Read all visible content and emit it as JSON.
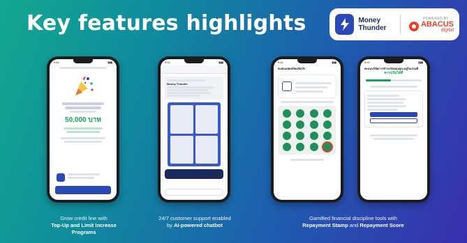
{
  "header": {
    "title": "Key features highlights",
    "brand_name": "Money Thunder",
    "powered_by": "POWERED BY",
    "partner_name": "ABACUS",
    "partner_sub": "digital"
  },
  "captions": [
    {
      "normal": "Grow credit line with",
      "bold": "Top-Up and Limit Increase Programs"
    },
    {
      "normal": "24/7 customer support enabled",
      "prefix": "by ",
      "bold": "AI-powered chatbot"
    },
    {
      "normal": "Gamified financial discipline tools with",
      "bold": "Repayment Stamp",
      "mid": " and ",
      "bold2": "Repayment Score"
    }
  ],
  "phones": {
    "p1_amount": "50,000 บาท",
    "p2_chat_title": "Money Thunder",
    "p3_title": "สะสมแสตมป์ชดเชิกภัก",
    "p4_title": "คะแนนวินัยการชำระเงินของคุณ อยู่ในเกณฑ์",
    "p4_status": "ควรปรับได้ดี"
  },
  "colors": {
    "brand_blue": "#2b49b4",
    "green": "#14a35b",
    "abacus_red": "#e8402a"
  }
}
